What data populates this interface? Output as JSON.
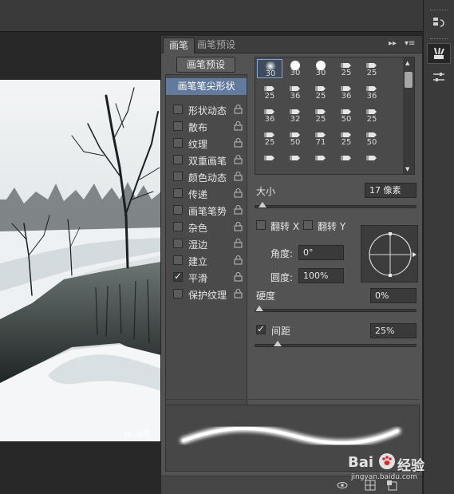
{
  "tabs": {
    "brush": "画笔",
    "brush_presets": "画笔预设"
  },
  "tab_controls": {
    "collapse": "▸▸",
    "menu": "▾≡"
  },
  "preset_button": "画笔预设",
  "brush_tip_shape": "画笔笔尖形状",
  "options": [
    {
      "label": "形状动态",
      "checked": false
    },
    {
      "label": "散布",
      "checked": false
    },
    {
      "label": "纹理",
      "checked": false
    },
    {
      "label": "双重画笔",
      "checked": false
    },
    {
      "label": "颜色动态",
      "checked": false
    },
    {
      "label": "传递",
      "checked": false
    },
    {
      "label": "画笔笔势",
      "checked": false
    },
    {
      "label": "杂色",
      "checked": false
    },
    {
      "label": "湿边",
      "checked": false
    },
    {
      "label": "建立",
      "checked": false
    },
    {
      "label": "平滑",
      "checked": true
    },
    {
      "label": "保护纹理",
      "checked": false
    }
  ],
  "brush_grid": [
    [
      "30",
      "30",
      "30",
      "25",
      "25"
    ],
    [
      "25",
      "36",
      "25",
      "36",
      "36"
    ],
    [
      "36",
      "32",
      "25",
      "50",
      "25"
    ],
    [
      "25",
      "50",
      "71",
      "25",
      "50"
    ],
    [
      "",
      "",
      "",
      "",
      ""
    ]
  ],
  "size": {
    "label": "大小",
    "value": "17 像素",
    "level": 0.02
  },
  "flip": {
    "x_label": "翻转 X",
    "y_label": "翻转 Y"
  },
  "angle": {
    "label": "角度:",
    "value": "0°"
  },
  "roundness": {
    "label": "圆度:",
    "value": "100%"
  },
  "hardness": {
    "label": "硬度",
    "value": "0%",
    "level": 0.0
  },
  "spacing": {
    "label": "间距",
    "value": "25%",
    "checked": true,
    "level": 0.12
  },
  "photo_caption": "Bi 动感",
  "watermark": {
    "logo": "Bai",
    "text": "经验",
    "url": "jingyan.baidu.com"
  },
  "colors": {
    "panel": "#535353",
    "selected_option": "#627a9c",
    "dark_field": "#3a3a3a"
  }
}
